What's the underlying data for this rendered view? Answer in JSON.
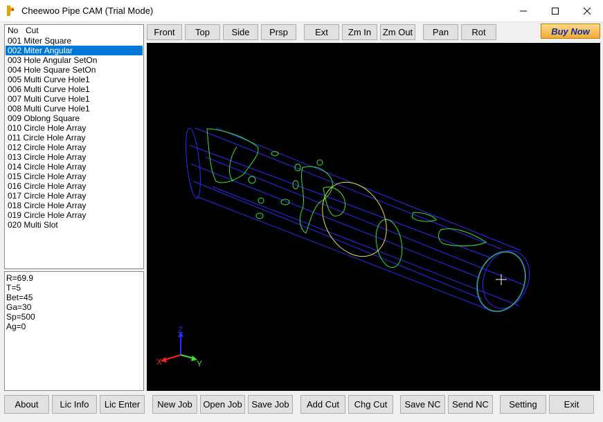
{
  "window": {
    "title": "Cheewoo Pipe CAM (Trial Mode)"
  },
  "list": {
    "header_no": "No",
    "header_cut": "Cut",
    "selected_index": 1,
    "items": [
      "001 Miter Square",
      "002 Miter Angular",
      "003 Hole Angular SetOn",
      "004 Hole Square SetOn",
      "005 Multi Curve Hole1",
      "006 Multi Curve Hole1",
      "007 Multi Curve Hole1",
      "008 Multi Curve Hole1",
      "009 Oblong Square",
      "010 Circle Hole Array",
      "011 Circle Hole Array",
      "012 Circle Hole Array",
      "013 Circle Hole Array",
      "014 Circle Hole Array",
      "015 Circle Hole Array",
      "016 Circle Hole Array",
      "017 Circle Hole Array",
      "018 Circle Hole Array",
      "019 Circle Hole Array",
      "020 Multi Slot"
    ]
  },
  "params": [
    "R=69.9",
    "T=5",
    "Bet=45",
    "Ga=30",
    "Sp=500",
    "Ag=0"
  ],
  "toolbar": {
    "front": "Front",
    "top": "Top",
    "side": "Side",
    "prsp": "Prsp",
    "ext": "Ext",
    "zoom_in": "Zm In",
    "zoom_out": "Zm Out",
    "pan": "Pan",
    "rot": "Rot",
    "buy_now": "Buy Now"
  },
  "axes": {
    "x": "X",
    "y": "Y",
    "z": "Z"
  },
  "bottom": {
    "about": "About",
    "lic_info": "Lic Info",
    "lic_enter": "Lic Enter",
    "new_job": "New Job",
    "open_job": "Open Job",
    "save_job": "Save Job",
    "add_cut": "Add Cut",
    "chg_cut": "Chg Cut",
    "save_nc": "Save NC",
    "send_nc": "Send NC",
    "setting": "Setting",
    "exit": "Exit"
  },
  "colors": {
    "pipe": "#2a2aff",
    "cut": "#33e633",
    "miter": "#e6e633",
    "selection": "#0078d7"
  }
}
